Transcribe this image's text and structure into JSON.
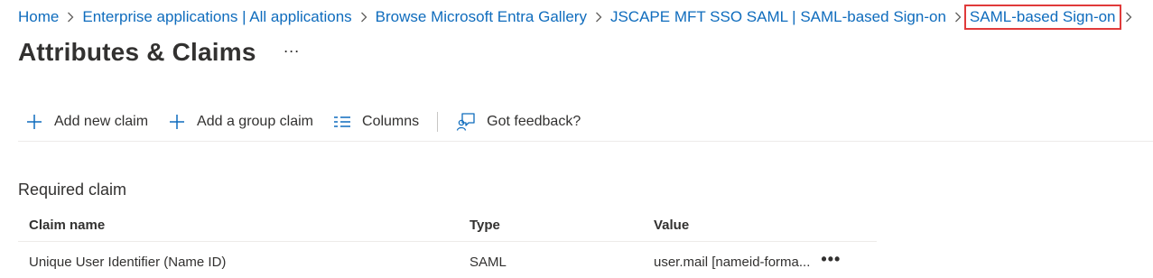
{
  "breadcrumb": {
    "items": [
      "Home",
      "Enterprise applications | All applications",
      "Browse Microsoft Entra Gallery",
      "JSCAPE MFT SSO SAML | SAML-based Sign-on",
      "SAML-based Sign-on"
    ]
  },
  "page": {
    "title": "Attributes & Claims",
    "more": "···"
  },
  "toolbar": {
    "add_claim": "Add new claim",
    "add_group_claim": "Add a group claim",
    "columns": "Columns",
    "feedback": "Got feedback?"
  },
  "section": {
    "title": "Required claim"
  },
  "table": {
    "headers": [
      "Claim name",
      "Type",
      "Value"
    ],
    "rows": [
      {
        "name": "Unique User Identifier (Name ID)",
        "type": "SAML",
        "value": "user.mail [nameid-forma...",
        "more": "•••"
      }
    ]
  },
  "colors": {
    "link": "#0f6cbd",
    "highlight_border": "#e03a3a",
    "text": "#323130"
  },
  "icons": [
    "chevron-right-icon",
    "plus-icon",
    "columns-icon",
    "feedback-icon",
    "more-icon"
  ]
}
